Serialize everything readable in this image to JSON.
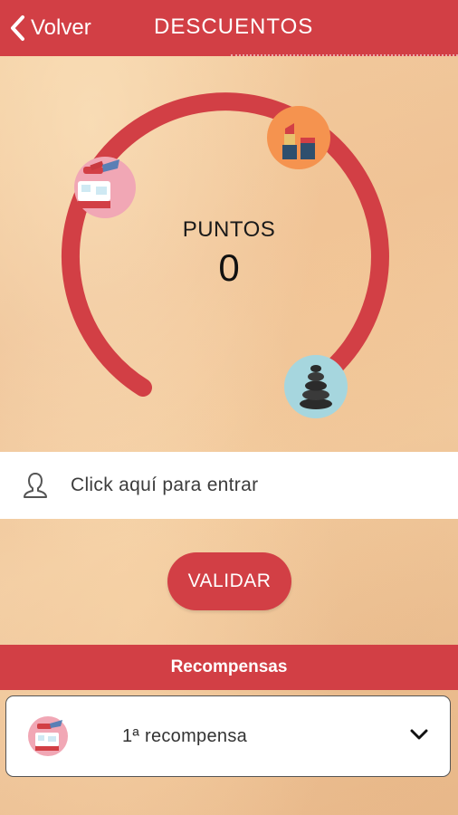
{
  "header": {
    "back_label": "Volver",
    "title": "DESCUENTOS",
    "icon_back": "chevron-left-icon"
  },
  "gauge": {
    "label": "PUNTOS",
    "value": "0",
    "progress": 0,
    "arc_color": "#d23f45",
    "milestones": [
      {
        "icon": "pedicure-icon",
        "color": "#f1a7b5"
      },
      {
        "icon": "lipstick-icon",
        "color": "#f5934f"
      },
      {
        "icon": "massage-stones-icon",
        "color": "#a6d6de"
      }
    ]
  },
  "login": {
    "icon": "user-icon",
    "text": "Click aquí para entrar"
  },
  "validate_button": "VALIDAR",
  "rewards": {
    "header": "Recompensas",
    "items": [
      {
        "label": "1ª recompensa",
        "icon": "pedicure-icon",
        "expand_icon": "chevron-down-icon"
      }
    ]
  },
  "colors": {
    "brand": "#d23f45",
    "white": "#ffffff",
    "text_dark": "#1a1a1a"
  }
}
